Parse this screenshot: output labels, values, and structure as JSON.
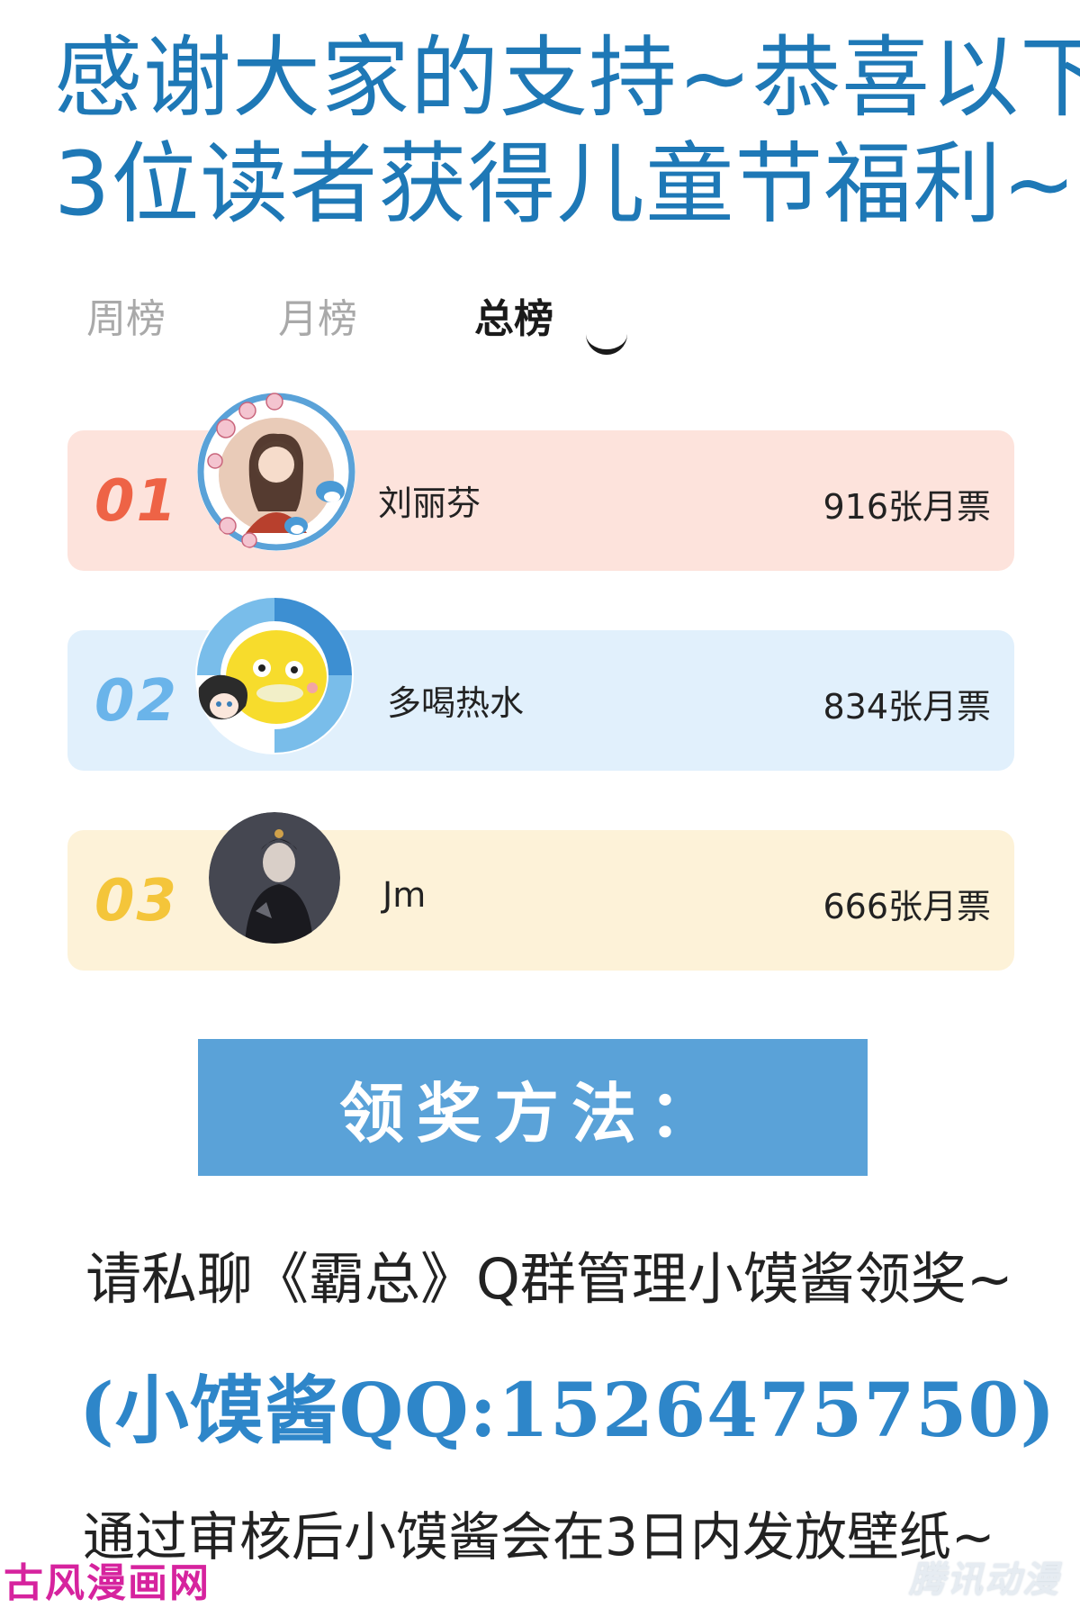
{
  "headline": {
    "line1": "感谢大家的支持~恭喜以下",
    "line2": "3位读者获得儿童节福利~"
  },
  "tabs": [
    {
      "label": "周榜",
      "active": false
    },
    {
      "label": "月榜",
      "active": false
    },
    {
      "label": "总榜",
      "active": true
    }
  ],
  "ranking": [
    {
      "rank": "01",
      "name": "刘丽芬",
      "votes": "916张月票",
      "bg_color": "#fde3dc",
      "rank_color": "#ee6346"
    },
    {
      "rank": "02",
      "name": "多喝热水",
      "votes": "834张月票",
      "bg_color": "#e1f0fc",
      "rank_color": "#6ab4ea"
    },
    {
      "rank": "03",
      "name": "Jm",
      "votes": "666张月票",
      "bg_color": "#fdf2d8",
      "rank_color": "#f4c53a"
    }
  ],
  "banner": {
    "text": "领奖方法：",
    "color": "#5aa2d8"
  },
  "instructions": {
    "line1": "请私聊《霸总》Q群管理小馍酱领奖~",
    "qq": "(小馍酱QQ:1526475750)",
    "line2": "通过审核后小馍酱会在3日内发放壁纸~"
  },
  "watermarks": {
    "left": "古风漫画网",
    "right": "腾讯动漫"
  },
  "colors": {
    "headline": "#1e78b6",
    "qq_text": "#2e86c9"
  }
}
